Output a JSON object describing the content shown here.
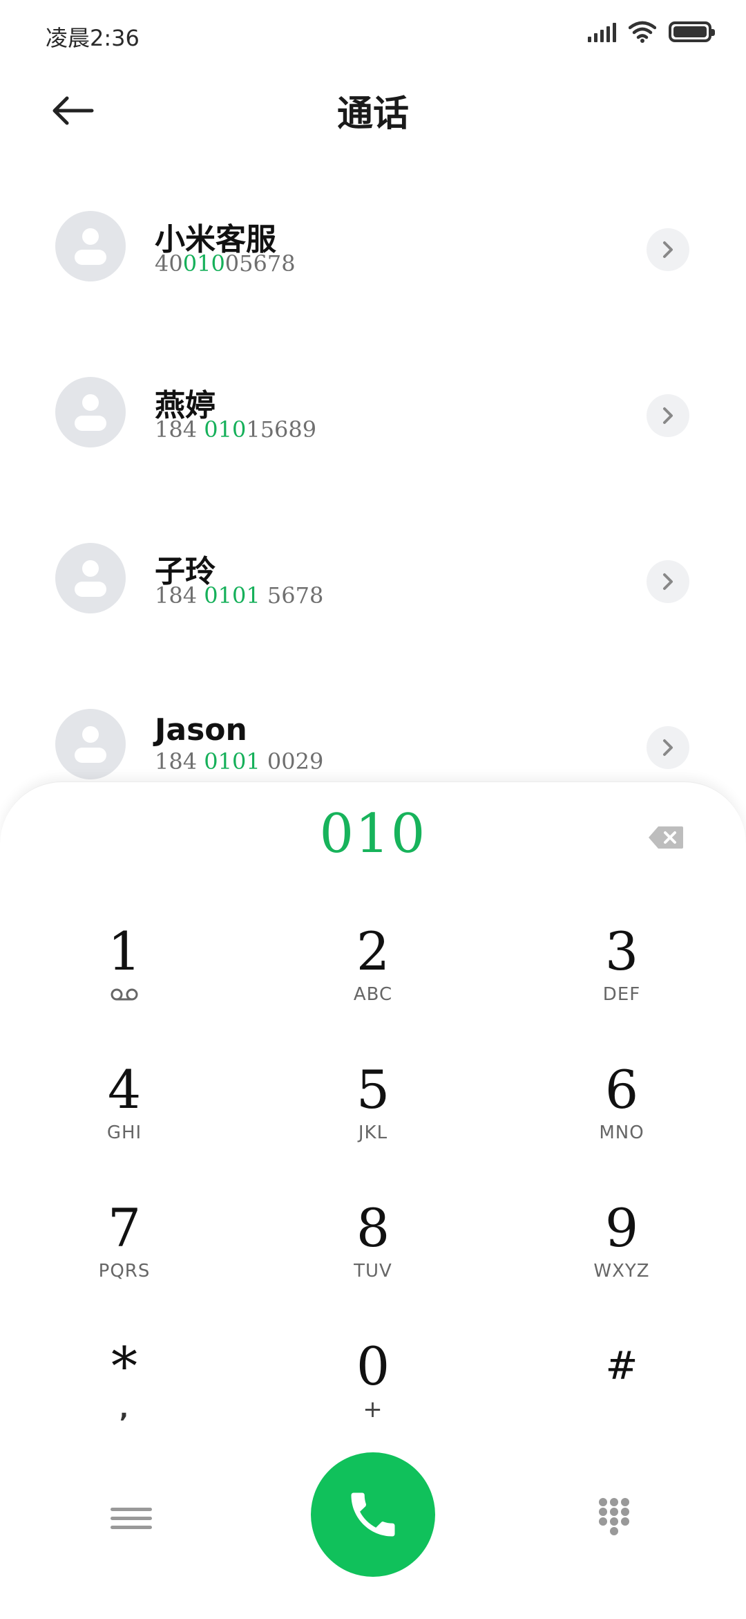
{
  "status_bar": {
    "time": "凌晨2:36",
    "icons": [
      "signal-icon",
      "wifi-icon",
      "battery-icon"
    ]
  },
  "header": {
    "title": "通话",
    "back_icon": "back-arrow-icon"
  },
  "contacts": [
    {
      "name": "小米客服",
      "number_pre": "40",
      "number_match": "010",
      "number_post": "05678"
    },
    {
      "name": "燕婷",
      "number_pre": "184 ",
      "number_match": "010",
      "number_post": "15689"
    },
    {
      "name": "子玲",
      "number_pre": "184 ",
      "number_match": "0101",
      "number_post": " 5678"
    },
    {
      "name": "Jason",
      "number_pre": "184 ",
      "number_match": "0101",
      "number_post": " 0029"
    }
  ],
  "dialer": {
    "input": "010",
    "keys": [
      {
        "digit": "1",
        "letters": ""
      },
      {
        "digit": "2",
        "letters": "ABC"
      },
      {
        "digit": "3",
        "letters": "DEF"
      },
      {
        "digit": "4",
        "letters": "GHI"
      },
      {
        "digit": "5",
        "letters": "JKL"
      },
      {
        "digit": "6",
        "letters": "MNO"
      },
      {
        "digit": "7",
        "letters": "PQRS"
      },
      {
        "digit": "8",
        "letters": "TUV"
      },
      {
        "digit": "9",
        "letters": "WXYZ"
      },
      {
        "digit": "*",
        "letters": ","
      },
      {
        "digit": "0",
        "letters": "+"
      },
      {
        "digit": "#",
        "letters": ""
      }
    ]
  },
  "colors": {
    "accent": "#16b05a",
    "call_button": "#10c15b",
    "avatar_bg": "#e3e5e9"
  }
}
